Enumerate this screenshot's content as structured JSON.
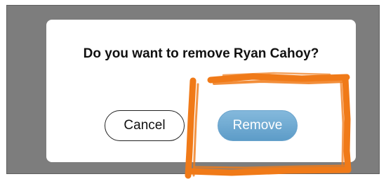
{
  "dialog": {
    "message": "Do you want to remove Ryan Cahoy?",
    "cancel_label": "Cancel",
    "remove_label": "Remove"
  },
  "colors": {
    "backdrop": "#7d7d7d",
    "remove_button": "#6aa8d3",
    "highlight": "#f07a18"
  },
  "annotation": {
    "icon": "hand-drawn-highlight-box"
  }
}
